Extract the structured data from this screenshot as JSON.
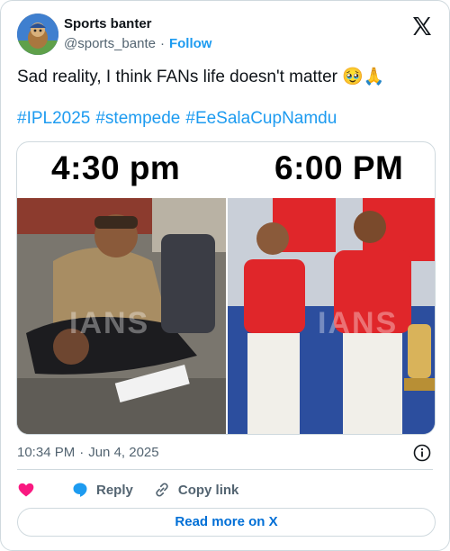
{
  "author": {
    "name": "Sports banter",
    "handle": "@sports_bante",
    "follow_label": "Follow"
  },
  "tweet": {
    "text": "Sad reality, I think FANs life doesn't matter",
    "emojis": "🥹🙏",
    "hashtags": [
      "#IPL2025",
      "#stempede",
      "#EeSalaCupNamdu"
    ]
  },
  "media": {
    "left_label": "4:30 pm",
    "right_label": "6:00 PM",
    "watermark": "IANS"
  },
  "meta": {
    "time": "10:34 PM",
    "date": "Jun 4, 2025"
  },
  "actions": {
    "reply_label": "Reply",
    "copy_link_label": "Copy link",
    "read_more_label": "Read more on X"
  },
  "colors": {
    "accent": "#1d9bf0",
    "like": "#f91880",
    "muted": "#536471",
    "jersey_red": "#e0262a"
  },
  "icons": [
    "x-logo-icon",
    "info-icon",
    "heart-icon",
    "reply-bubble-icon",
    "link-icon"
  ]
}
